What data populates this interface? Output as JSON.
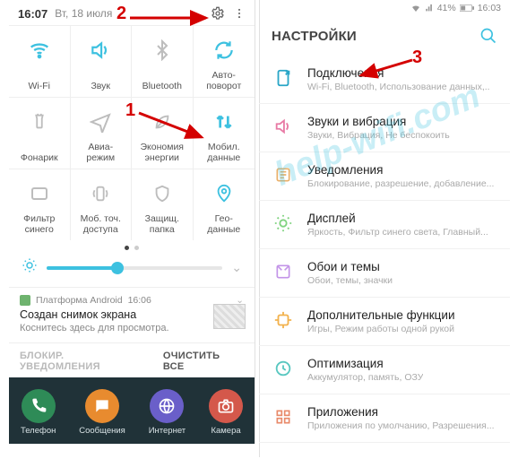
{
  "annotations": {
    "n1": "1",
    "n2": "2",
    "n3": "3"
  },
  "watermark": "help-wifi.com",
  "left": {
    "status": {
      "time": "16:07",
      "date": "Вт, 18 июля"
    },
    "qs": {
      "wifi": "Wi-Fi",
      "sound": "Звук",
      "bluetooth": "Bluetooth",
      "autorotate": "Авто-\nповорот",
      "flash": "Фонарик",
      "airplane": "Авиа-\nрежим",
      "powersave": "Экономия\nэнергии",
      "mobiledata": "Мобил.\nданные",
      "bluefilter": "Фильтр\nсинего",
      "hotspot": "Моб. точ.\nдоступа",
      "secure": "Защищ.\nпапка",
      "geo": "Гео-\nданные"
    },
    "notif": {
      "app": "Платформа Android",
      "time": "16:06",
      "title": "Создан снимок экрана",
      "body": "Коснитесь здесь для просмотра."
    },
    "actions": {
      "block": "БЛОКИР. УВЕДОМЛЕНИЯ",
      "clear": "ОЧИСТИТЬ ВСЕ"
    },
    "dock": {
      "phone": "Телефон",
      "msg": "Сообщения",
      "web": "Интернет",
      "cam": "Камера"
    }
  },
  "right": {
    "status": {
      "battery": "41%",
      "time": "16:03"
    },
    "header": "НАСТРОЙКИ",
    "items": [
      {
        "title": "Подключения",
        "sub": "Wi-Fi, Bluetooth, Использование данных,..",
        "color": "#2aa6c7",
        "icon": "connections"
      },
      {
        "title": "Звуки и вибрация",
        "sub": "Звуки, Вибрация, Не беспокоить",
        "color": "#e87aa5",
        "icon": "sound"
      },
      {
        "title": "Уведомления",
        "sub": "Блокирование, разрешение, добавление...",
        "color": "#eab06a",
        "icon": "notif"
      },
      {
        "title": "Дисплей",
        "sub": "Яркость, Фильтр синего света, Главный...",
        "color": "#7fd37f",
        "icon": "display"
      },
      {
        "title": "Обои и темы",
        "sub": "Обои, темы, значки",
        "color": "#c394e8",
        "icon": "wallpaper"
      },
      {
        "title": "Дополнительные функции",
        "sub": "Игры, Режим работы одной рукой",
        "color": "#f2b24d",
        "icon": "advanced"
      },
      {
        "title": "Оптимизация",
        "sub": "Аккумулятор, память, ОЗУ",
        "color": "#58c7c0",
        "icon": "maint"
      },
      {
        "title": "Приложения",
        "sub": "Приложения по умолчанию, Разрешения...",
        "color": "#e88a6a",
        "icon": "apps"
      }
    ]
  }
}
